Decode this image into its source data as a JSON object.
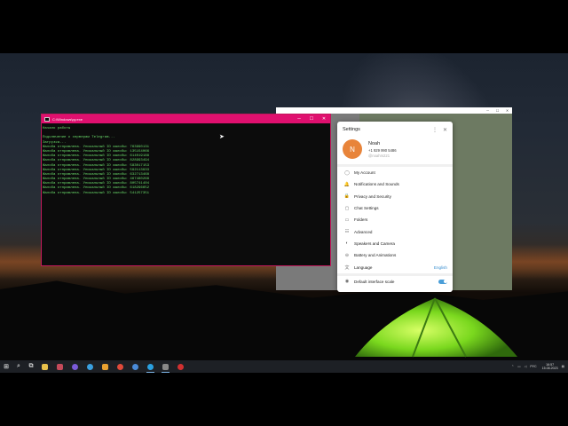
{
  "console": {
    "title": "C:\\Windows\\py.exe",
    "lines": [
      "Начало работы",
      "",
      "Подключение к серверам Telegram...",
      "Загрузка...",
      "Жалоба отправлена. Уникальный ID жалобы: 763990131",
      "Жалоба отправлена. Уникальный ID жалобы: 135154066",
      "Жалоба отправлена. Уникальный ID жалобы: 614019188",
      "Жалоба отправлена. Уникальный ID жалобы: 828993494",
      "Жалоба отправлена. Уникальный ID жалобы: 583017153",
      "Жалоба отправлена. Уникальный ID жалобы: 592113933",
      "Жалоба отправлена. Уникальный ID жалобы: 632713468",
      "Жалоба отправлена. Уникальный ID жалобы: 467480268",
      "Жалоба отправлена. Уникальный ID жалобы: 805741404",
      "Жалоба отправлена. Уникальный ID жалобы: 618296652",
      "Жалоба отправлена. Уникальный ID жалобы: 541257351"
    ]
  },
  "settings": {
    "title": "Settings",
    "profile": {
      "initial": "N",
      "name": "Noah",
      "phone": "+1 929 990 5486",
      "username": "@noahm221"
    },
    "items": [
      {
        "icon": "user-icon",
        "glyph": "◯",
        "label": "My Account",
        "value": ""
      },
      {
        "icon": "bell-icon",
        "glyph": "🔔",
        "label": "Notifications and Sounds",
        "value": ""
      },
      {
        "icon": "lock-icon",
        "glyph": "🔒",
        "label": "Privacy and Security",
        "value": ""
      },
      {
        "icon": "chat-icon",
        "glyph": "▢",
        "label": "Chat Settings",
        "value": ""
      },
      {
        "icon": "folder-icon",
        "glyph": "▭",
        "label": "Folders",
        "value": ""
      },
      {
        "icon": "sliders-icon",
        "glyph": "☷",
        "label": "Advanced",
        "value": ""
      },
      {
        "icon": "speaker-icon",
        "glyph": "◐",
        "label": "Speakers and Camera",
        "value": ""
      },
      {
        "icon": "battery-icon",
        "glyph": "⊖",
        "label": "Battery and Animations",
        "value": ""
      },
      {
        "icon": "language-icon",
        "glyph": "文",
        "label": "Language",
        "value": "English"
      }
    ],
    "scale": {
      "label": "Default interface scale",
      "enabled": true
    }
  },
  "taskbar": {
    "tray_lang": "РУС",
    "time": "16:57",
    "date": "15.08.2023",
    "accent": "#7fb6e8"
  }
}
